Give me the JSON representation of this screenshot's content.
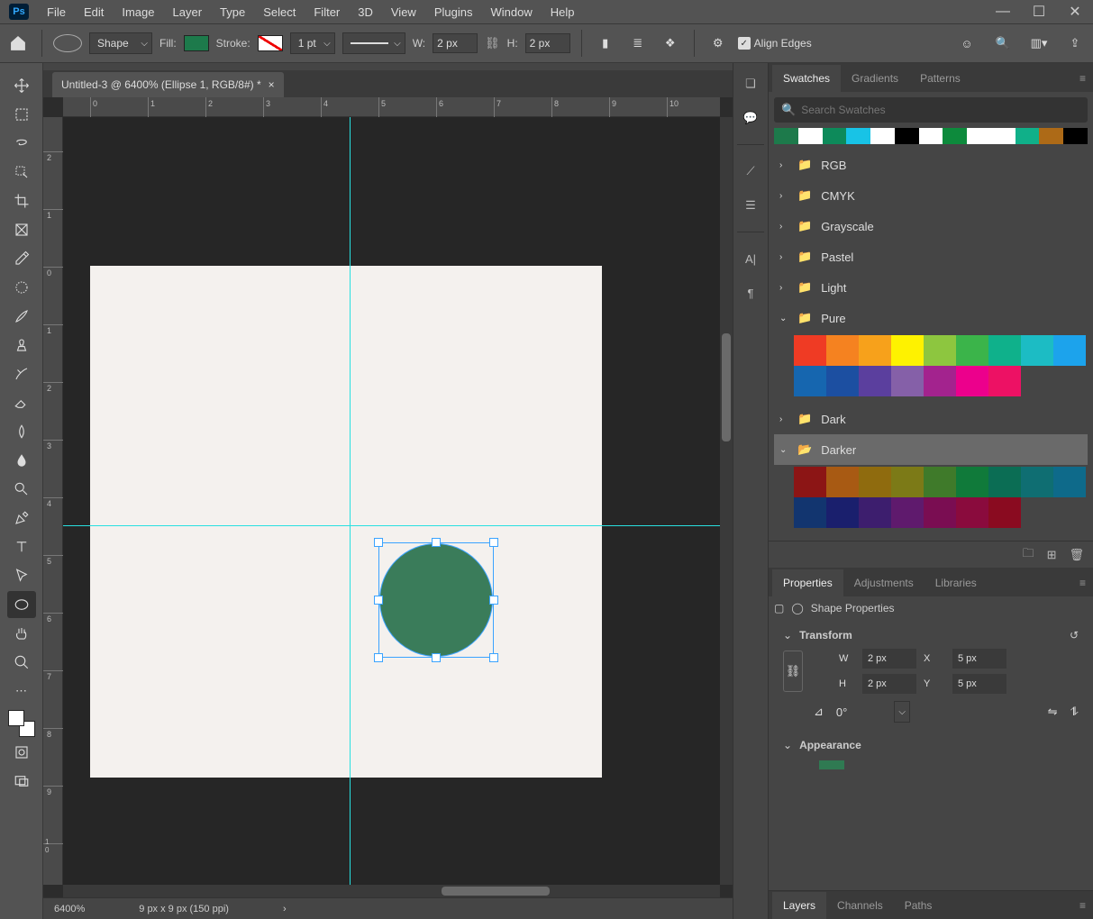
{
  "menu": {
    "items": [
      "File",
      "Edit",
      "Image",
      "Layer",
      "Type",
      "Select",
      "Filter",
      "3D",
      "View",
      "Plugins",
      "Window",
      "Help"
    ]
  },
  "optionsBar": {
    "modeLabel": "Shape",
    "fillLabel": "Fill:",
    "fillColor": "#1d7a4b",
    "strokeLabel": "Stroke:",
    "strokeWidth": "1 pt",
    "wLabel": "W:",
    "wVal": "2 px",
    "hLabel": "H:",
    "hVal": "2 px",
    "alignEdges": "Align Edges"
  },
  "document": {
    "tabTitle": "Untitled-3 @ 6400% (Ellipse 1, RGB/8#) *",
    "zoom": "6400%",
    "dims": "9 px x 9 px (150 ppi)"
  },
  "swatchesPanel": {
    "tabs": [
      "Swatches",
      "Gradients",
      "Patterns"
    ],
    "searchPlaceholder": "Search Swatches",
    "recent": [
      "#1d7a4b",
      "#ffffff",
      "#0d8a5a",
      "#18c3e6",
      "#ffffff",
      "#000000",
      "#ffffff",
      "#0d8a3c",
      "#ffffff",
      "#ffffff",
      "#10b089",
      "#ad6a17",
      "#000000"
    ],
    "folders": [
      "RGB",
      "CMYK",
      "Grayscale",
      "Pastel",
      "Light"
    ],
    "pure": {
      "label": "Pure",
      "colors": [
        "#ef3b24",
        "#f58220",
        "#f7a11b",
        "#fef200",
        "#8dc63f",
        "#3bb44a",
        "#0fb18b",
        "#1cbcc4",
        "#1ca3ec",
        "#1666af",
        "#1c4fa1",
        "#5b3f9e",
        "#8560a8",
        "#a3238e",
        "#ec008c",
        "#ed1164"
      ]
    },
    "darkLabel": "Dark",
    "darker": {
      "label": "Darker",
      "colors": [
        "#8c1515",
        "#a85a13",
        "#8f6b0e",
        "#7c7a17",
        "#3f7a2a",
        "#107a3a",
        "#0b6d54",
        "#0f6e72",
        "#0e6a8a",
        "#12356f",
        "#1a1f6d",
        "#3d1e6e",
        "#5f1a6d",
        "#7a0d52",
        "#8a0b3d",
        "#8a0b20"
      ]
    }
  },
  "propertiesPanel": {
    "tabs": [
      "Properties",
      "Adjustments",
      "Libraries"
    ],
    "title": "Shape Properties",
    "transform": {
      "label": "Transform",
      "W": "2 px",
      "H": "2 px",
      "X": "5 px",
      "Y": "5 px",
      "rot": "0°"
    },
    "appearanceLabel": "Appearance"
  },
  "bottomTabs": [
    "Layers",
    "Channels",
    "Paths"
  ]
}
